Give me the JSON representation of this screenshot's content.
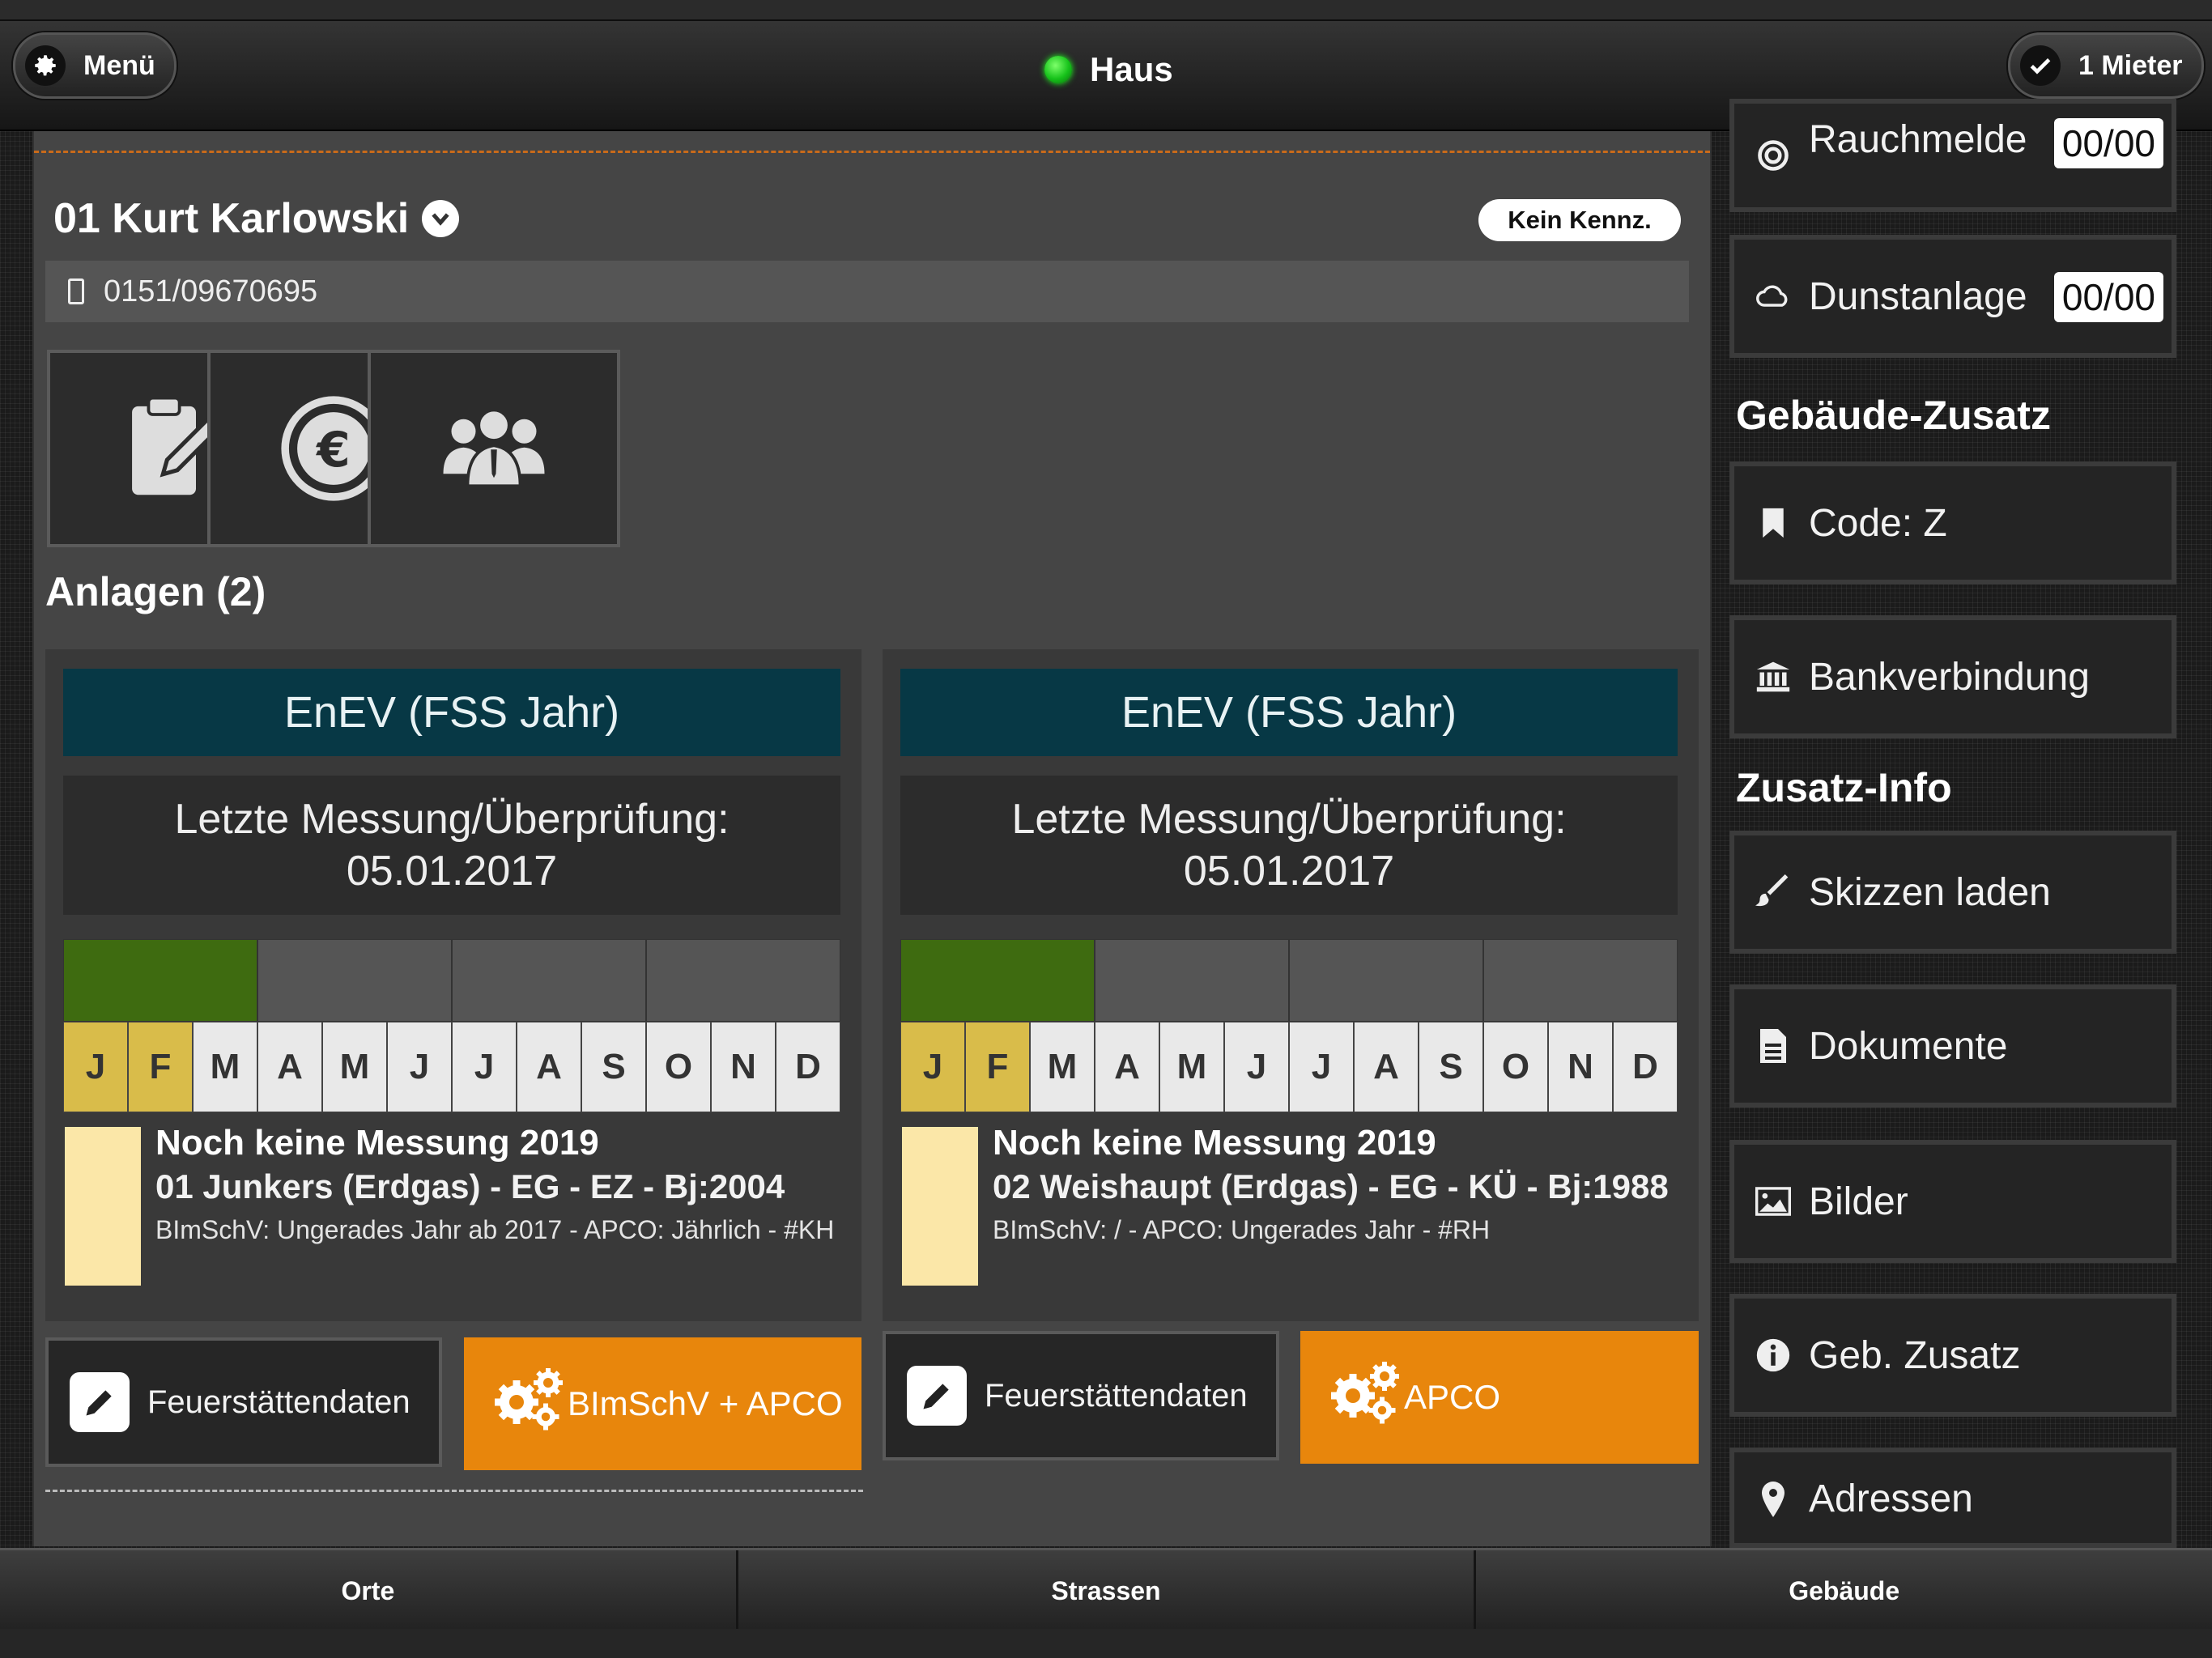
{
  "header": {
    "menu_label": "Menü",
    "title": "Haus",
    "tenant_count_label": "1 Mieter"
  },
  "tenant": {
    "name": "01 Kurt Karlowski",
    "plate_button": "Kein Kennz.",
    "phone": "0151/09670695"
  },
  "section_title": "Anlagen (2)",
  "cards": [
    {
      "header": "EnEV (FSS Jahr)",
      "measurement_line1": "Letzte Messung/Überprüfung:",
      "measurement_line2": "05.01.2017",
      "months": [
        "J",
        "F",
        "M",
        "A",
        "M",
        "J",
        "J",
        "A",
        "S",
        "O",
        "N",
        "D"
      ],
      "highlighted_months": [
        0,
        1
      ],
      "bar_segments_active": [
        true,
        false,
        false,
        false
      ],
      "title": "Noch keine Messung 2019",
      "device": "01 Junkers (Erdgas) - EG - EZ - Bj:2004",
      "details": "BImSchV: Ungerades Jahr ab 2017 - APCO: Jährlich - #KH",
      "btn_data": "Feuerstättendaten",
      "btn_action": "BImSchV + APCO"
    },
    {
      "header": "EnEV (FSS Jahr)",
      "measurement_line1": "Letzte Messung/Überprüfung:",
      "measurement_line2": "05.01.2017",
      "months": [
        "J",
        "F",
        "M",
        "A",
        "M",
        "J",
        "J",
        "A",
        "S",
        "O",
        "N",
        "D"
      ],
      "highlighted_months": [
        0,
        1
      ],
      "bar_segments_active": [
        true,
        false,
        false,
        false
      ],
      "title": "Noch keine Messung 2019",
      "device": "02 Weishaupt (Erdgas) - EG - KÜ - Bj:1988",
      "details": "BImSchV: / - APCO: Ungerades Jahr - #RH",
      "btn_data": "Feuerstättendaten",
      "btn_action": "APCO"
    }
  ],
  "sidebar": {
    "smoke": {
      "label": "Rauchmelde",
      "count": "00/00"
    },
    "hood": {
      "label": "Dunstanlage",
      "count": "00/00"
    },
    "building_heading": "Gebäude-Zusatz",
    "code": "Code: Z",
    "bank": "Bankverbindung",
    "extra_heading": "Zusatz-Info",
    "sketches": "Skizzen laden",
    "documents": "Dokumente",
    "images": "Bilder",
    "geb_zusatz": "Geb. Zusatz",
    "addresses": "Adressen"
  },
  "bottom_nav": [
    "Orte",
    "Strassen",
    "Gebäude"
  ],
  "colors": {
    "accent_orange": "#e8860c",
    "card_header": "#073845",
    "active_green": "#3e6b10",
    "month_highlight": "#d9bc4a",
    "status_green": "#16c21a"
  }
}
